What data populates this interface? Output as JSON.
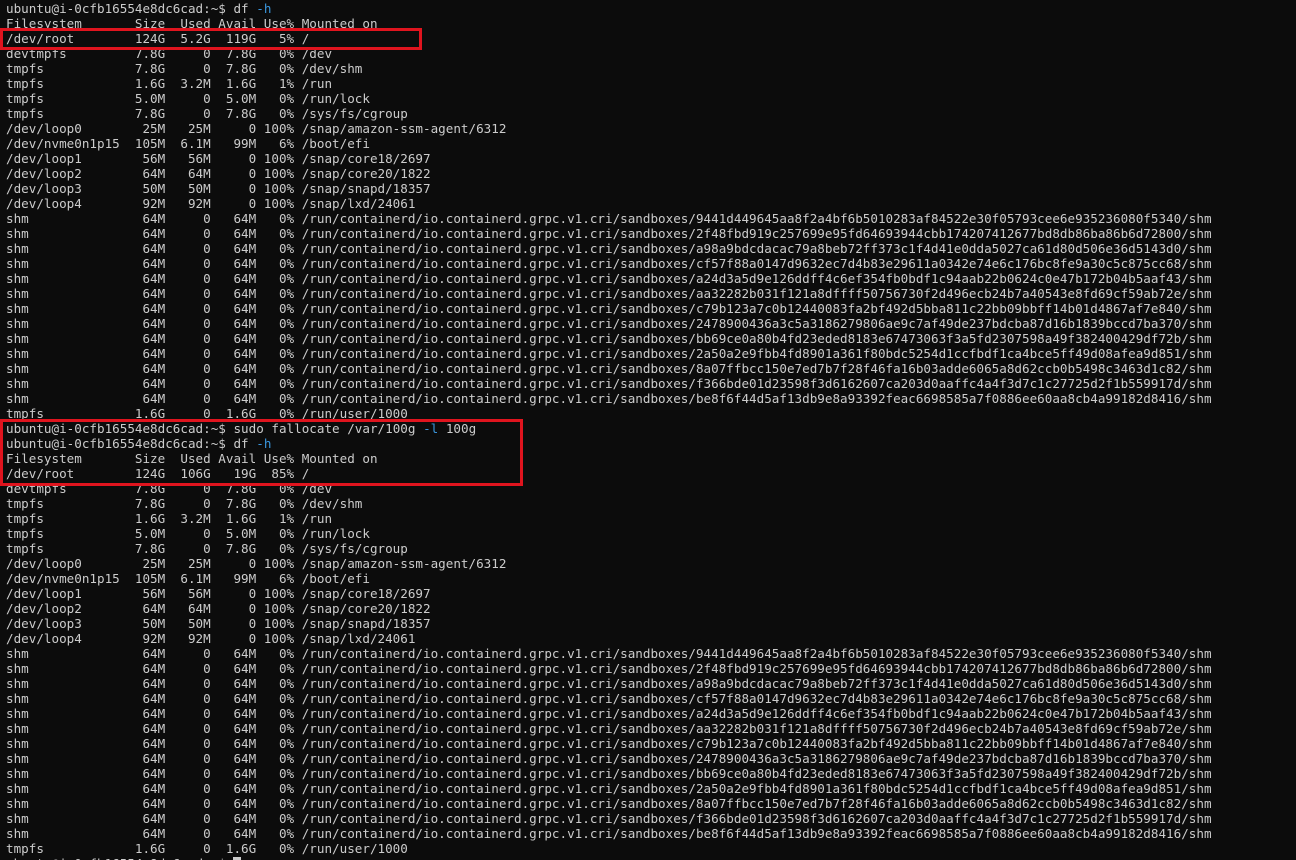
{
  "terminal": {
    "prompt": "ubuntu@i-0cfb16554e8dc6cad:~$ ",
    "commands": [
      {
        "name": "df",
        "args": "",
        "flag": "-h"
      },
      {
        "name": "sudo fallocate",
        "args": "/var/100g",
        "flag": "-l",
        "value": "100g"
      },
      {
        "name": "df",
        "args": "",
        "flag": "-h"
      }
    ],
    "header": "Filesystem       Size  Used Avail Use% Mounted on",
    "first_output": [
      "/dev/root        124G  5.2G  119G   5% /",
      "devtmpfs         7.8G     0  7.8G   0% /dev",
      "tmpfs            7.8G     0  7.8G   0% /dev/shm",
      "tmpfs            1.6G  3.2M  1.6G   1% /run",
      "tmpfs            5.0M     0  5.0M   0% /run/lock",
      "tmpfs            7.8G     0  7.8G   0% /sys/fs/cgroup",
      "/dev/loop0        25M   25M     0 100% /snap/amazon-ssm-agent/6312",
      "/dev/nvme0n1p15  105M  6.1M   99M   6% /boot/efi",
      "/dev/loop1        56M   56M     0 100% /snap/core18/2697",
      "/dev/loop2        64M   64M     0 100% /snap/core20/1822",
      "/dev/loop3        50M   50M     0 100% /snap/snapd/18357",
      "/dev/loop4        92M   92M     0 100% /snap/lxd/24061",
      "shm               64M     0   64M   0% /run/containerd/io.containerd.grpc.v1.cri/sandboxes/9441d449645aa8f2a4bf6b5010283af84522e30f05793cee6e935236080f5340/shm",
      "shm               64M     0   64M   0% /run/containerd/io.containerd.grpc.v1.cri/sandboxes/2f48fbd919c257699e95fd64693944cbb174207412677bd8db86ba86b6d72800/shm",
      "shm               64M     0   64M   0% /run/containerd/io.containerd.grpc.v1.cri/sandboxes/a98a9bdcdacac79a8beb72ff373c1f4d41e0dda5027ca61d80d506e36d5143d0/shm",
      "shm               64M     0   64M   0% /run/containerd/io.containerd.grpc.v1.cri/sandboxes/cf57f88a0147d9632ec7d4b83e29611a0342e74e6c176bc8fe9a30c5c875cc68/shm",
      "shm               64M     0   64M   0% /run/containerd/io.containerd.grpc.v1.cri/sandboxes/a24d3a5d9e126ddff4c6ef354fb0bdf1c94aab22b0624c0e47b172b04b5aaf43/shm",
      "shm               64M     0   64M   0% /run/containerd/io.containerd.grpc.v1.cri/sandboxes/aa32282b031f121a8dffff50756730f2d496ecb24b7a40543e8fd69cf59ab72e/shm",
      "shm               64M     0   64M   0% /run/containerd/io.containerd.grpc.v1.cri/sandboxes/c79b123a7c0b12440083fa2bf492d5bba811c22bb09bbff14b01d4867af7e840/shm",
      "shm               64M     0   64M   0% /run/containerd/io.containerd.grpc.v1.cri/sandboxes/2478900436a3c5a3186279806ae9c7af49de237bdcba87d16b1839bccd7ba370/shm",
      "shm               64M     0   64M   0% /run/containerd/io.containerd.grpc.v1.cri/sandboxes/bb69ce0a80b4fd23eded8183e67473063f3a5fd2307598a49f382400429df72b/shm",
      "shm               64M     0   64M   0% /run/containerd/io.containerd.grpc.v1.cri/sandboxes/2a50a2e9fbb4fd8901a361f80bdc5254d1ccfbdf1ca4bce5ff49d08afea9d851/shm",
      "shm               64M     0   64M   0% /run/containerd/io.containerd.grpc.v1.cri/sandboxes/8a07ffbcc150e7ed7b7f28f46fa16b03adde6065a8d62ccb0b5498c3463d1c82/shm",
      "shm               64M     0   64M   0% /run/containerd/io.containerd.grpc.v1.cri/sandboxes/f366bde01d23598f3d6162607ca203d0aaffc4a4f3d7c1c27725d2f1b559917d/shm",
      "shm               64M     0   64M   0% /run/containerd/io.containerd.grpc.v1.cri/sandboxes/be8f6f44d5af13db9e8a93392feac6698585a7f0886ee60aa8cb4a99182d8416/shm",
      "tmpfs            1.6G     0  1.6G   0% /run/user/1000"
    ],
    "second_output": [
      "/dev/root        124G  106G   19G  85% /",
      "devtmpfs         7.8G     0  7.8G   0% /dev",
      "tmpfs            7.8G     0  7.8G   0% /dev/shm",
      "tmpfs            1.6G  3.2M  1.6G   1% /run",
      "tmpfs            5.0M     0  5.0M   0% /run/lock",
      "tmpfs            7.8G     0  7.8G   0% /sys/fs/cgroup",
      "/dev/loop0        25M   25M     0 100% /snap/amazon-ssm-agent/6312",
      "/dev/nvme0n1p15  105M  6.1M   99M   6% /boot/efi",
      "/dev/loop1        56M   56M     0 100% /snap/core18/2697",
      "/dev/loop2        64M   64M     0 100% /snap/core20/1822",
      "/dev/loop3        50M   50M     0 100% /snap/snapd/18357",
      "/dev/loop4        92M   92M     0 100% /snap/lxd/24061",
      "shm               64M     0   64M   0% /run/containerd/io.containerd.grpc.v1.cri/sandboxes/9441d449645aa8f2a4bf6b5010283af84522e30f05793cee6e935236080f5340/shm",
      "shm               64M     0   64M   0% /run/containerd/io.containerd.grpc.v1.cri/sandboxes/2f48fbd919c257699e95fd64693944cbb174207412677bd8db86ba86b6d72800/shm",
      "shm               64M     0   64M   0% /run/containerd/io.containerd.grpc.v1.cri/sandboxes/a98a9bdcdacac79a8beb72ff373c1f4d41e0dda5027ca61d80d506e36d5143d0/shm",
      "shm               64M     0   64M   0% /run/containerd/io.containerd.grpc.v1.cri/sandboxes/cf57f88a0147d9632ec7d4b83e29611a0342e74e6c176bc8fe9a30c5c875cc68/shm",
      "shm               64M     0   64M   0% /run/containerd/io.containerd.grpc.v1.cri/sandboxes/a24d3a5d9e126ddff4c6ef354fb0bdf1c94aab22b0624c0e47b172b04b5aaf43/shm",
      "shm               64M     0   64M   0% /run/containerd/io.containerd.grpc.v1.cri/sandboxes/aa32282b031f121a8dffff50756730f2d496ecb24b7a40543e8fd69cf59ab72e/shm",
      "shm               64M     0   64M   0% /run/containerd/io.containerd.grpc.v1.cri/sandboxes/c79b123a7c0b12440083fa2bf492d5bba811c22bb09bbff14b01d4867af7e840/shm",
      "shm               64M     0   64M   0% /run/containerd/io.containerd.grpc.v1.cri/sandboxes/2478900436a3c5a3186279806ae9c7af49de237bdcba87d16b1839bccd7ba370/shm",
      "shm               64M     0   64M   0% /run/containerd/io.containerd.grpc.v1.cri/sandboxes/bb69ce0a80b4fd23eded8183e67473063f3a5fd2307598a49f382400429df72b/shm",
      "shm               64M     0   64M   0% /run/containerd/io.containerd.grpc.v1.cri/sandboxes/2a50a2e9fbb4fd8901a361f80bdc5254d1ccfbdf1ca4bce5ff49d08afea9d851/shm",
      "shm               64M     0   64M   0% /run/containerd/io.containerd.grpc.v1.cri/sandboxes/8a07ffbcc150e7ed7b7f28f46fa16b03adde6065a8d62ccb0b5498c3463d1c82/shm",
      "shm               64M     0   64M   0% /run/containerd/io.containerd.grpc.v1.cri/sandboxes/f366bde01d23598f3d6162607ca203d0aaffc4a4f3d7c1c27725d2f1b559917d/shm",
      "shm               64M     0   64M   0% /run/containerd/io.containerd.grpc.v1.cri/sandboxes/be8f6f44d5af13db9e8a93392feac6698585a7f0886ee60aa8cb4a99182d8416/shm",
      "tmpfs            1.6G     0  1.6G   0% /run/user/1000"
    ]
  },
  "colors": {
    "background": "#0c0c0c",
    "text": "#cccccc",
    "flag": "#3a96dd",
    "highlight": "#e0141e"
  }
}
